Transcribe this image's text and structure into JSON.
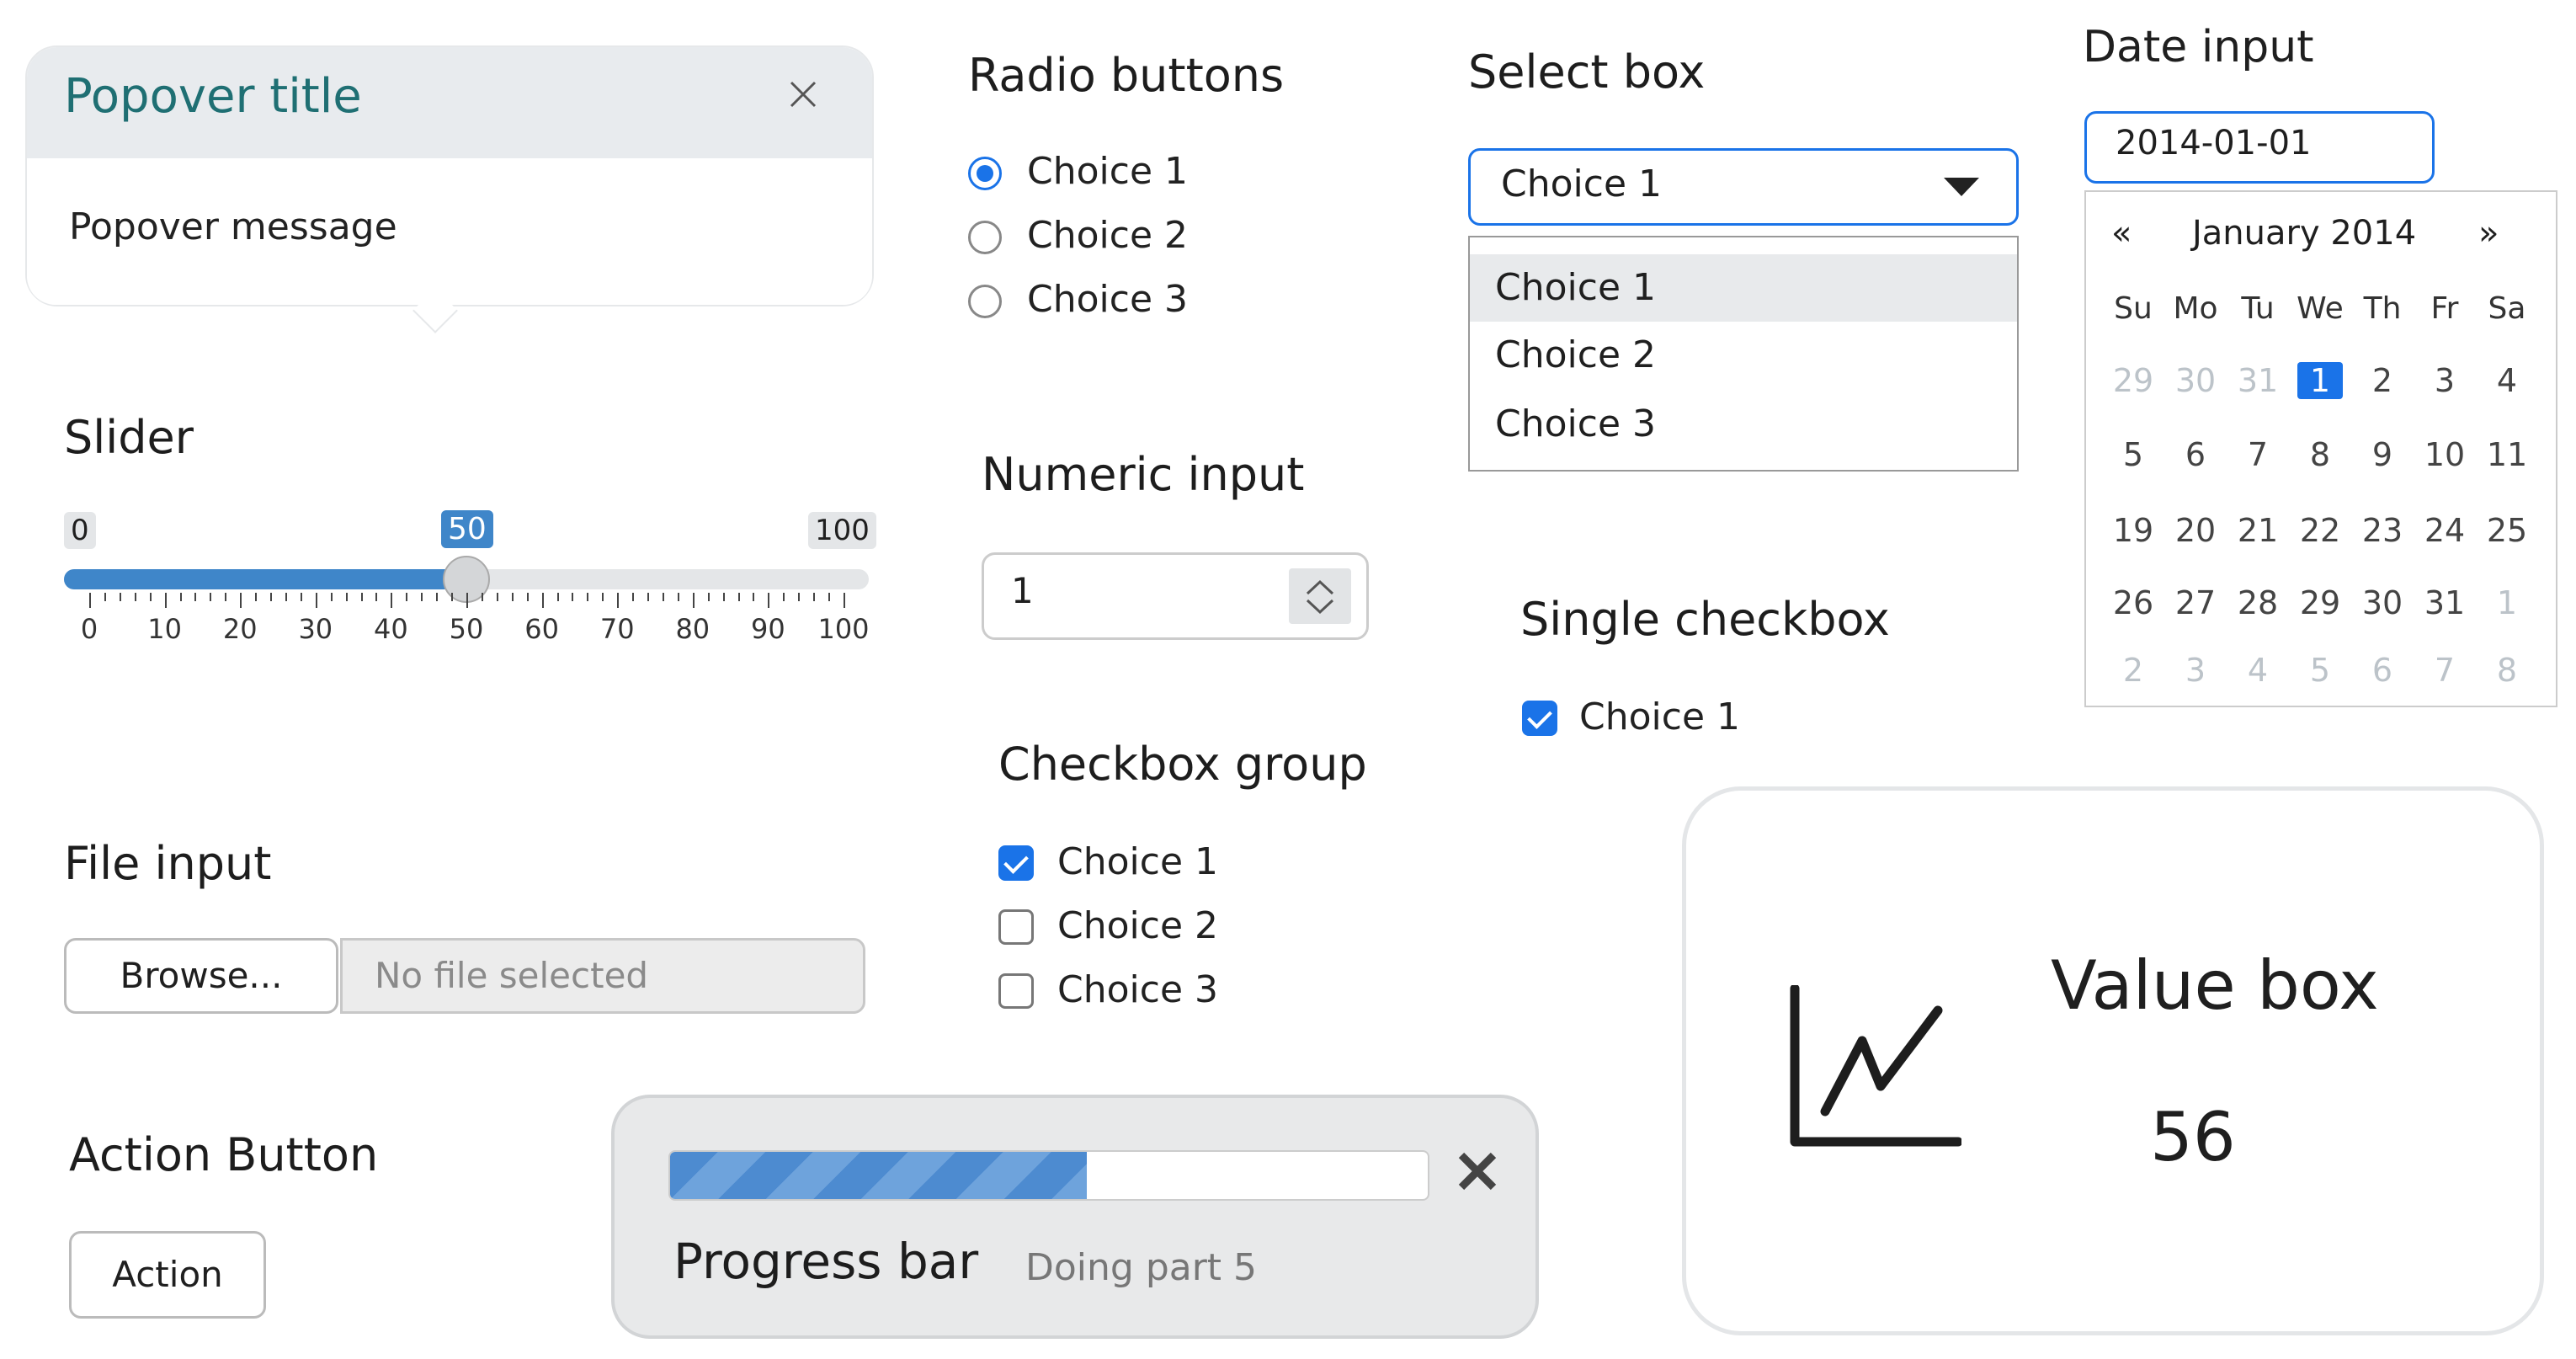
{
  "popover": {
    "title": "Popover title",
    "message": "Popover message",
    "close_icon": "close-icon"
  },
  "slider": {
    "heading": "Slider",
    "min_label": "0",
    "max_label": "100",
    "value_label": "50",
    "value": 50,
    "min": 0,
    "max": 100,
    "ticks": [
      "0",
      "10",
      "20",
      "30",
      "40",
      "50",
      "60",
      "70",
      "80",
      "90",
      "100"
    ]
  },
  "file_input": {
    "heading": "File input",
    "button": "Browse...",
    "placeholder": "No file selected"
  },
  "action": {
    "heading": "Action Button",
    "button": "Action"
  },
  "radio": {
    "heading": "Radio buttons",
    "choices": [
      "Choice 1",
      "Choice 2",
      "Choice 3"
    ],
    "selected": 0
  },
  "numeric": {
    "heading": "Numeric input",
    "value": "1"
  },
  "checkbox_group": {
    "heading": "Checkbox group",
    "choices": [
      "Choice 1",
      "Choice 2",
      "Choice 3"
    ],
    "checked": [
      true,
      false,
      false
    ]
  },
  "select": {
    "heading": "Select box",
    "value": "Choice 1",
    "options": [
      "Choice 1",
      "Choice 2",
      "Choice 3"
    ]
  },
  "single_checkbox": {
    "heading": "Single checkbox",
    "label": "Choice 1",
    "checked": true
  },
  "date": {
    "heading": "Date input",
    "value": "2014-01-01",
    "month_label": "January 2014",
    "prev": "«",
    "next": "»",
    "weekdays": [
      "Su",
      "Mo",
      "Tu",
      "We",
      "Th",
      "Fr",
      "Sa"
    ],
    "weeks": [
      [
        "29",
        "30",
        "31",
        "1",
        "2",
        "3",
        "4"
      ],
      [
        "5",
        "6",
        "7",
        "8",
        "9",
        "10",
        "11"
      ],
      [
        "19",
        "20",
        "21",
        "22",
        "23",
        "24",
        "25"
      ],
      [
        "26",
        "27",
        "28",
        "29",
        "30",
        "31",
        "1"
      ],
      [
        "2",
        "3",
        "4",
        "5",
        "6",
        "7",
        "8"
      ]
    ]
  },
  "progress": {
    "title": "Progress bar",
    "detail": "Doing part 5",
    "fraction": 0.55,
    "close": "X"
  },
  "value_box": {
    "title": "Value box",
    "value": "56",
    "icon": "line-chart-icon"
  },
  "colors": {
    "accent": "#1a73e8",
    "slider_fill": "#3f86c9",
    "popover_title": "#1f6f73",
    "progress_fill": "#4d8bd0"
  }
}
